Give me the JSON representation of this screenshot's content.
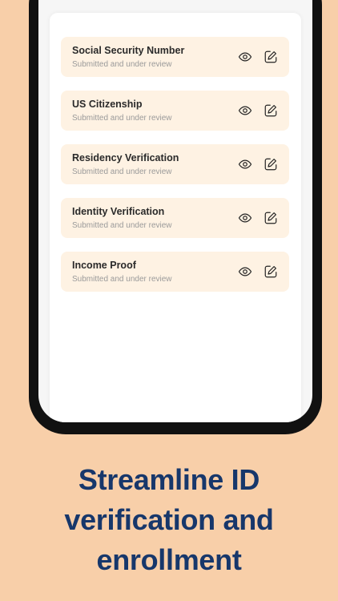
{
  "documents": [
    {
      "title": "Social Security Number",
      "status": "Submitted and under review"
    },
    {
      "title": "US Citizenship",
      "status": "Submitted and under review"
    },
    {
      "title": "Residency Verification",
      "status": "Submitted and under review"
    },
    {
      "title": "Identity Verification",
      "status": "Submitted and under review"
    },
    {
      "title": "Income Proof",
      "status": "Submitted and under review"
    }
  ],
  "icons": {
    "view": "eye-icon",
    "edit": "pencil-edit-icon"
  },
  "headline": {
    "line1": "Streamline ID",
    "line2": "verification and",
    "line3": "enrollment"
  },
  "colors": {
    "background": "#F8CFA9",
    "item_background": "#FEF2E3",
    "headline": "#17376B"
  }
}
